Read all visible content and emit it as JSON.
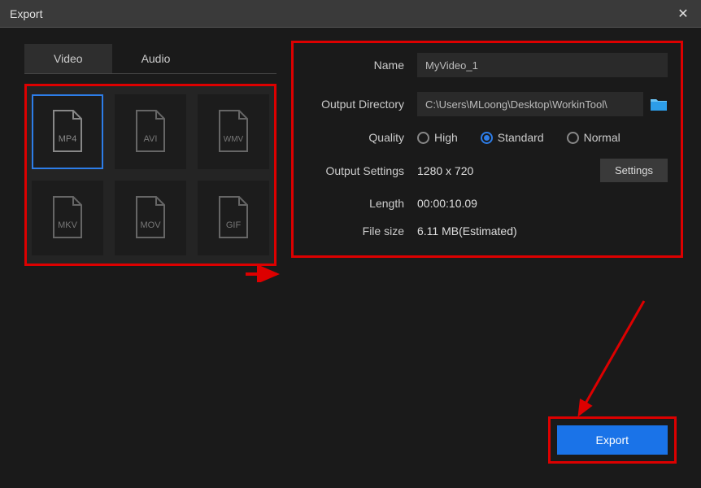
{
  "window": {
    "title": "Export"
  },
  "tabs": {
    "video": "Video",
    "audio": "Audio"
  },
  "formats": {
    "mp4": "MP4",
    "avi": "AVI",
    "wmv": "WMV",
    "mkv": "MKV",
    "mov": "MOV",
    "gif": "GIF"
  },
  "labels": {
    "name": "Name",
    "output_dir": "Output Directory",
    "quality": "Quality",
    "output_settings": "Output Settings",
    "length": "Length",
    "file_size": "File size"
  },
  "values": {
    "name": "MyVideo_1",
    "output_dir": "C:\\Users\\MLoong\\Desktop\\WorkinTool\\",
    "resolution": "1280 x 720",
    "length": "00:00:10.09",
    "file_size": "6.11 MB(Estimated)"
  },
  "quality": {
    "high": "High",
    "standard": "Standard",
    "normal": "Normal"
  },
  "buttons": {
    "settings": "Settings",
    "export": "Export"
  }
}
